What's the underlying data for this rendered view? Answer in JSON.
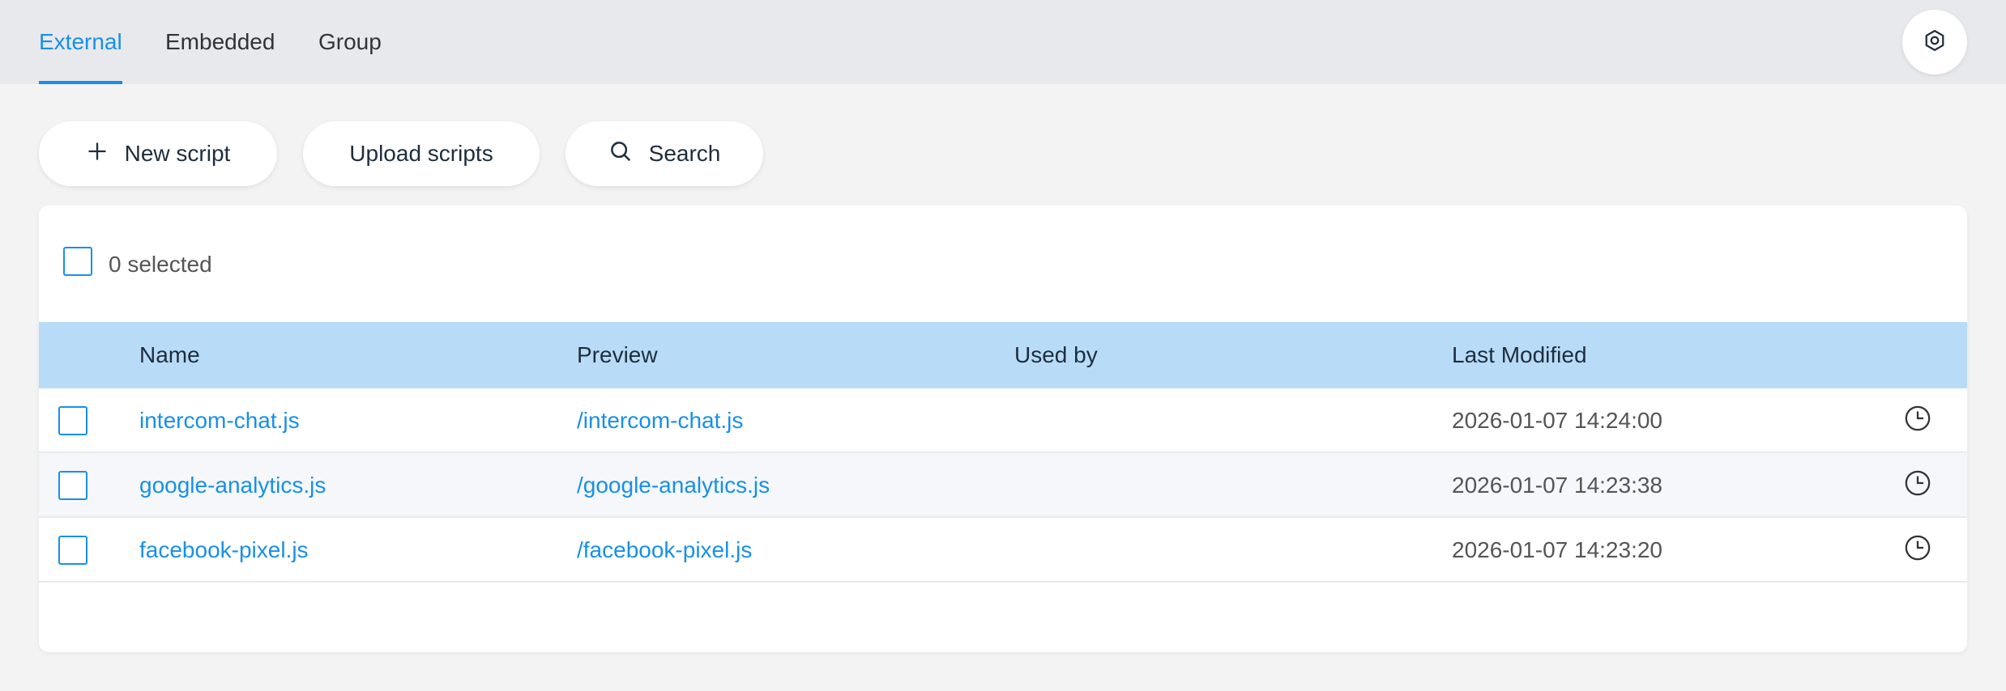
{
  "tabs": [
    {
      "label": "External",
      "active": true
    },
    {
      "label": "Embedded",
      "active": false
    },
    {
      "label": "Group",
      "active": false
    }
  ],
  "settings": {
    "icon": "gear-icon"
  },
  "toolbar": {
    "new_script": "New script",
    "upload_scripts": "Upload scripts",
    "search": "Search"
  },
  "selection": {
    "label": "0 selected"
  },
  "table": {
    "columns": [
      "Name",
      "Preview",
      "Used by",
      "Last Modified"
    ],
    "rows": [
      {
        "name": "intercom-chat.js",
        "preview": "/intercom-chat.js",
        "used_by": "",
        "modified": "2026-01-07 14:24:00"
      },
      {
        "name": "google-analytics.js",
        "preview": "/google-analytics.js",
        "used_by": "",
        "modified": "2026-01-07 14:23:38"
      },
      {
        "name": "facebook-pixel.js",
        "preview": "/facebook-pixel.js",
        "used_by": "",
        "modified": "2026-01-07 14:23:20"
      }
    ]
  },
  "colors": {
    "accent": "#1890e8",
    "header_bg": "#b8dcf7",
    "topbar_bg": "#e8e9ed",
    "page_bg": "#f2f3f2"
  }
}
